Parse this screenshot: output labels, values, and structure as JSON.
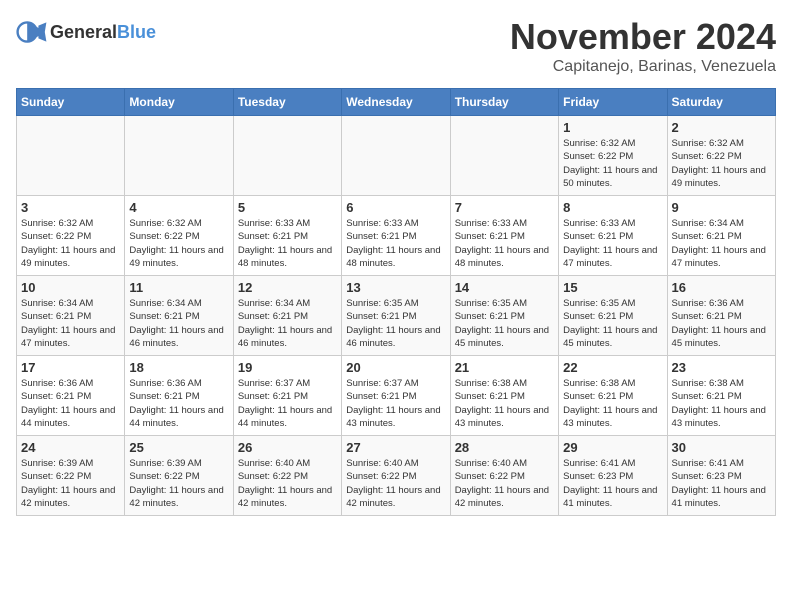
{
  "header": {
    "logo_general": "General",
    "logo_blue": "Blue",
    "month_title": "November 2024",
    "location": "Capitanejo, Barinas, Venezuela"
  },
  "days_of_week": [
    "Sunday",
    "Monday",
    "Tuesday",
    "Wednesday",
    "Thursday",
    "Friday",
    "Saturday"
  ],
  "weeks": [
    [
      {
        "day": "",
        "info": ""
      },
      {
        "day": "",
        "info": ""
      },
      {
        "day": "",
        "info": ""
      },
      {
        "day": "",
        "info": ""
      },
      {
        "day": "",
        "info": ""
      },
      {
        "day": "1",
        "info": "Sunrise: 6:32 AM\nSunset: 6:22 PM\nDaylight: 11 hours and 50 minutes."
      },
      {
        "day": "2",
        "info": "Sunrise: 6:32 AM\nSunset: 6:22 PM\nDaylight: 11 hours and 49 minutes."
      }
    ],
    [
      {
        "day": "3",
        "info": "Sunrise: 6:32 AM\nSunset: 6:22 PM\nDaylight: 11 hours and 49 minutes."
      },
      {
        "day": "4",
        "info": "Sunrise: 6:32 AM\nSunset: 6:22 PM\nDaylight: 11 hours and 49 minutes."
      },
      {
        "day": "5",
        "info": "Sunrise: 6:33 AM\nSunset: 6:21 PM\nDaylight: 11 hours and 48 minutes."
      },
      {
        "day": "6",
        "info": "Sunrise: 6:33 AM\nSunset: 6:21 PM\nDaylight: 11 hours and 48 minutes."
      },
      {
        "day": "7",
        "info": "Sunrise: 6:33 AM\nSunset: 6:21 PM\nDaylight: 11 hours and 48 minutes."
      },
      {
        "day": "8",
        "info": "Sunrise: 6:33 AM\nSunset: 6:21 PM\nDaylight: 11 hours and 47 minutes."
      },
      {
        "day": "9",
        "info": "Sunrise: 6:34 AM\nSunset: 6:21 PM\nDaylight: 11 hours and 47 minutes."
      }
    ],
    [
      {
        "day": "10",
        "info": "Sunrise: 6:34 AM\nSunset: 6:21 PM\nDaylight: 11 hours and 47 minutes."
      },
      {
        "day": "11",
        "info": "Sunrise: 6:34 AM\nSunset: 6:21 PM\nDaylight: 11 hours and 46 minutes."
      },
      {
        "day": "12",
        "info": "Sunrise: 6:34 AM\nSunset: 6:21 PM\nDaylight: 11 hours and 46 minutes."
      },
      {
        "day": "13",
        "info": "Sunrise: 6:35 AM\nSunset: 6:21 PM\nDaylight: 11 hours and 46 minutes."
      },
      {
        "day": "14",
        "info": "Sunrise: 6:35 AM\nSunset: 6:21 PM\nDaylight: 11 hours and 45 minutes."
      },
      {
        "day": "15",
        "info": "Sunrise: 6:35 AM\nSunset: 6:21 PM\nDaylight: 11 hours and 45 minutes."
      },
      {
        "day": "16",
        "info": "Sunrise: 6:36 AM\nSunset: 6:21 PM\nDaylight: 11 hours and 45 minutes."
      }
    ],
    [
      {
        "day": "17",
        "info": "Sunrise: 6:36 AM\nSunset: 6:21 PM\nDaylight: 11 hours and 44 minutes."
      },
      {
        "day": "18",
        "info": "Sunrise: 6:36 AM\nSunset: 6:21 PM\nDaylight: 11 hours and 44 minutes."
      },
      {
        "day": "19",
        "info": "Sunrise: 6:37 AM\nSunset: 6:21 PM\nDaylight: 11 hours and 44 minutes."
      },
      {
        "day": "20",
        "info": "Sunrise: 6:37 AM\nSunset: 6:21 PM\nDaylight: 11 hours and 43 minutes."
      },
      {
        "day": "21",
        "info": "Sunrise: 6:38 AM\nSunset: 6:21 PM\nDaylight: 11 hours and 43 minutes."
      },
      {
        "day": "22",
        "info": "Sunrise: 6:38 AM\nSunset: 6:21 PM\nDaylight: 11 hours and 43 minutes."
      },
      {
        "day": "23",
        "info": "Sunrise: 6:38 AM\nSunset: 6:21 PM\nDaylight: 11 hours and 43 minutes."
      }
    ],
    [
      {
        "day": "24",
        "info": "Sunrise: 6:39 AM\nSunset: 6:22 PM\nDaylight: 11 hours and 42 minutes."
      },
      {
        "day": "25",
        "info": "Sunrise: 6:39 AM\nSunset: 6:22 PM\nDaylight: 11 hours and 42 minutes."
      },
      {
        "day": "26",
        "info": "Sunrise: 6:40 AM\nSunset: 6:22 PM\nDaylight: 11 hours and 42 minutes."
      },
      {
        "day": "27",
        "info": "Sunrise: 6:40 AM\nSunset: 6:22 PM\nDaylight: 11 hours and 42 minutes."
      },
      {
        "day": "28",
        "info": "Sunrise: 6:40 AM\nSunset: 6:22 PM\nDaylight: 11 hours and 42 minutes."
      },
      {
        "day": "29",
        "info": "Sunrise: 6:41 AM\nSunset: 6:23 PM\nDaylight: 11 hours and 41 minutes."
      },
      {
        "day": "30",
        "info": "Sunrise: 6:41 AM\nSunset: 6:23 PM\nDaylight: 11 hours and 41 minutes."
      }
    ]
  ]
}
